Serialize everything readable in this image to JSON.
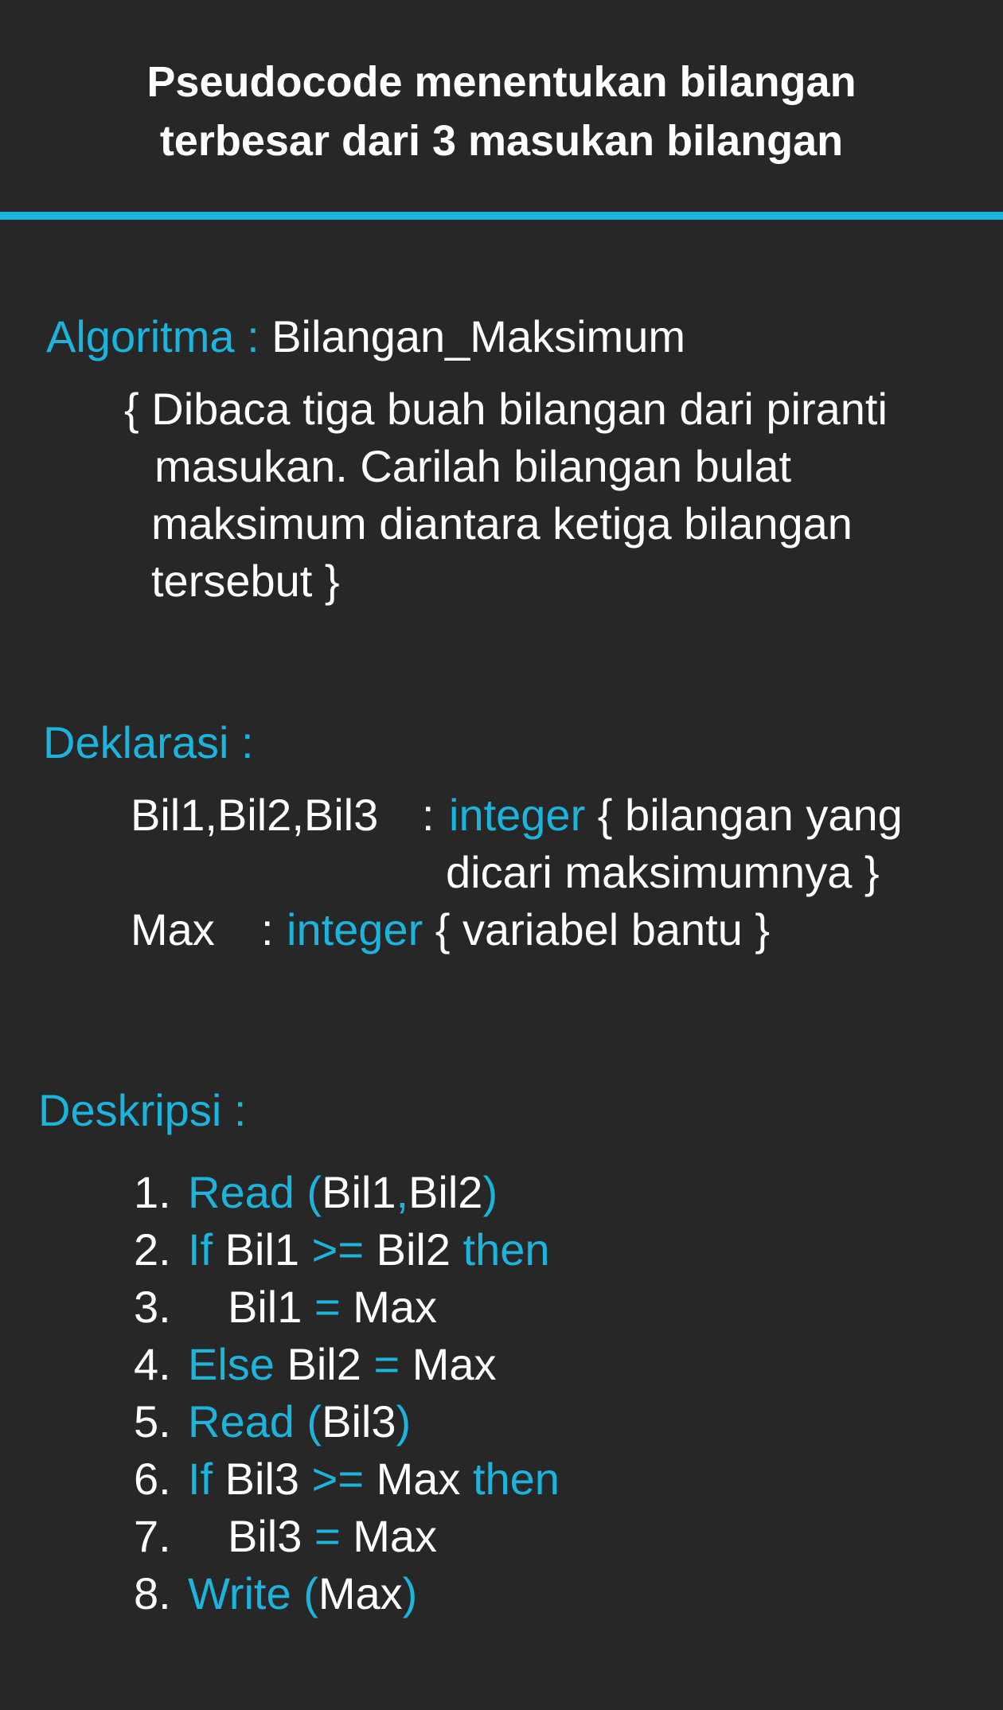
{
  "title": {
    "line1": "Pseudocode menentukan bilangan",
    "line2": "terbesar dari 3 masukan bilangan"
  },
  "colors": {
    "background": "#272727",
    "accent": "#1bb4dc",
    "text": "#ffffff"
  },
  "algoritma": {
    "label": "Algoritma :",
    "name": "Bilangan_Maksimum",
    "comment_lines": [
      "{ Dibaca tiga buah bilangan dari piranti",
      "masukan. Carilah bilangan bulat",
      "maksimum diantara ketiga bilangan",
      "tersebut }"
    ]
  },
  "deklarasi": {
    "label": "Deklarasi :",
    "bil_vars": "Bil1,Bil2,Bil3",
    "bil_colon": ":",
    "bil_type": "integer",
    "bil_comment_line1": "{ bilangan yang",
    "bil_comment_line2": "dicari maksimumnya }",
    "max_var": "Max",
    "max_colon": ":",
    "max_type": "integer",
    "max_comment": "{ variabel bantu }"
  },
  "deskripsi": {
    "label": "Deskripsi :",
    "steps": [
      {
        "num": "1.",
        "parts": [
          {
            "t": "Read (",
            "k": true
          },
          {
            "t": "Bil1",
            "k": false
          },
          {
            "t": ",",
            "k": true
          },
          {
            "t": "Bil2",
            "k": false
          },
          {
            "t": ")",
            "k": true
          }
        ]
      },
      {
        "num": "2.",
        "parts": [
          {
            "t": "If",
            "k": true
          },
          {
            "t": " Bil1 ",
            "k": false
          },
          {
            "t": ">=",
            "k": true
          },
          {
            "t": " Bil2 ",
            "k": false
          },
          {
            "t": "then",
            "k": true
          }
        ]
      },
      {
        "num": "3.",
        "indent": true,
        "parts": [
          {
            "t": "Bil1 ",
            "k": false
          },
          {
            "t": "=",
            "k": true
          },
          {
            "t": " Max",
            "k": false
          }
        ]
      },
      {
        "num": "4.",
        "parts": [
          {
            "t": "Else",
            "k": true
          },
          {
            "t": " Bil2 ",
            "k": false
          },
          {
            "t": "=",
            "k": true
          },
          {
            "t": " Max",
            "k": false
          }
        ]
      },
      {
        "num": "5.",
        "parts": [
          {
            "t": "Read (",
            "k": true
          },
          {
            "t": "Bil3",
            "k": false
          },
          {
            "t": ")",
            "k": true
          }
        ]
      },
      {
        "num": "6.",
        "parts": [
          {
            "t": "If",
            "k": true
          },
          {
            "t": " Bil3 ",
            "k": false
          },
          {
            "t": ">=",
            "k": true
          },
          {
            "t": " Max ",
            "k": false
          },
          {
            "t": "then",
            "k": true
          }
        ]
      },
      {
        "num": "7.",
        "indent": true,
        "parts": [
          {
            "t": "Bil3 ",
            "k": false
          },
          {
            "t": "=",
            "k": true
          },
          {
            "t": " Max",
            "k": false
          }
        ]
      },
      {
        "num": "8.",
        "parts": [
          {
            "t": "Write (",
            "k": true
          },
          {
            "t": "Max",
            "k": false
          },
          {
            "t": ")",
            "k": true
          }
        ]
      }
    ]
  }
}
